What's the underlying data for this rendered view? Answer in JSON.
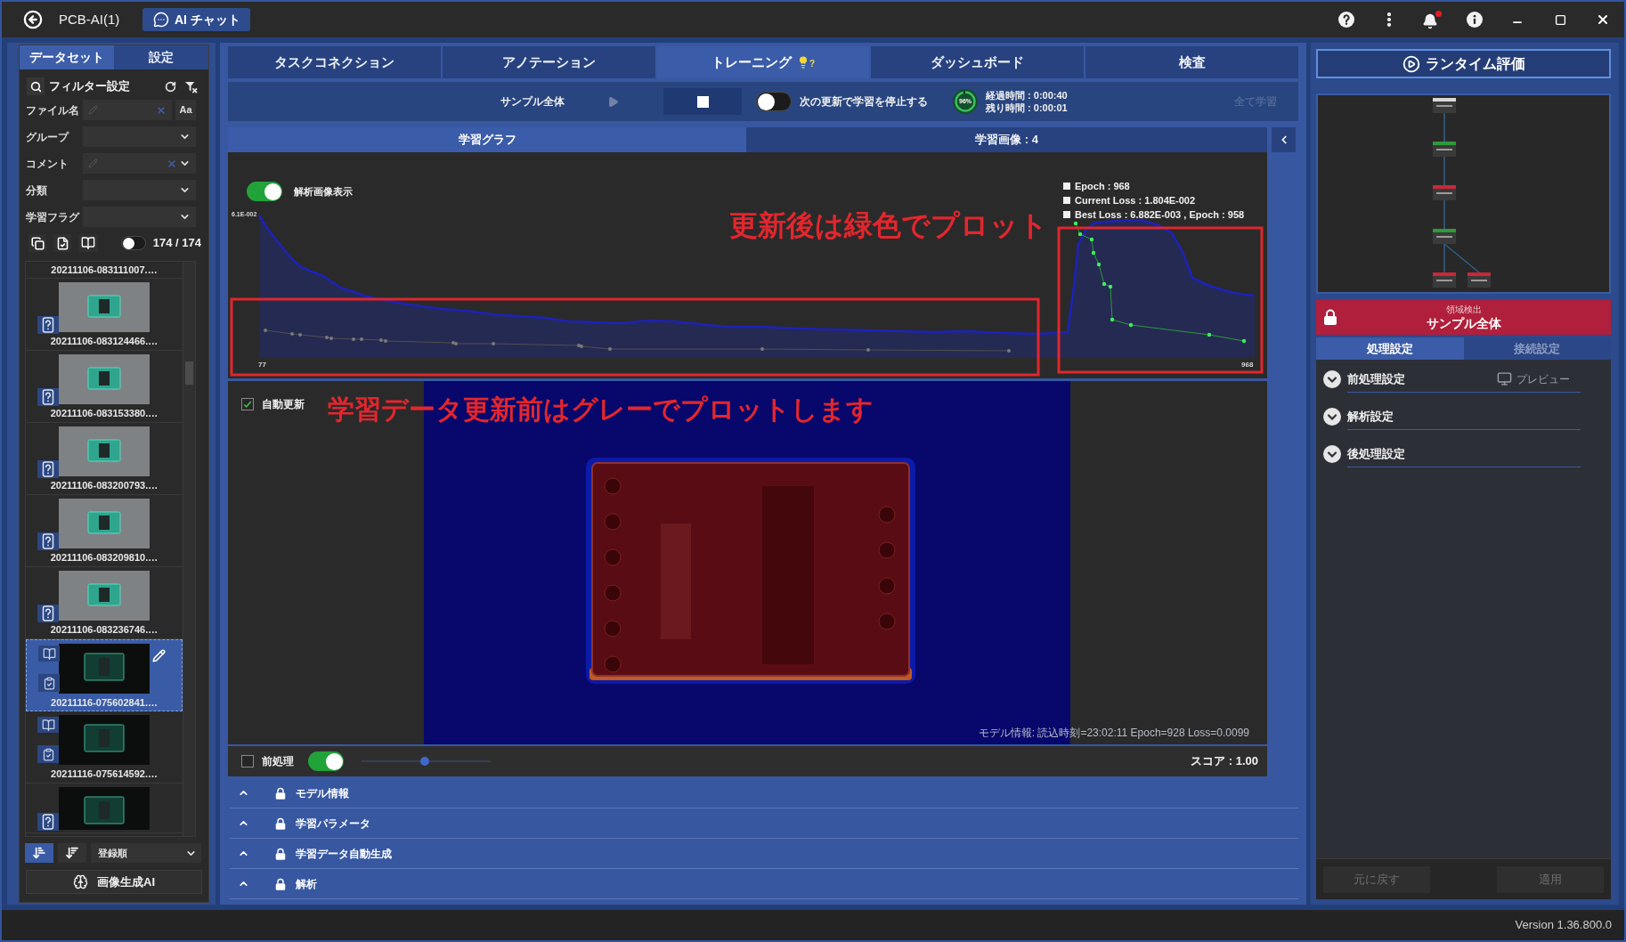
{
  "title_bar": {
    "project": "PCB-AI(1)",
    "chat_button": "AI チャット",
    "notifications_unread": true
  },
  "sidebar": {
    "tabs": [
      {
        "label": "データセット",
        "selected": true
      },
      {
        "label": "設定",
        "selected": false
      }
    ],
    "filter": {
      "title": "フィルター設定",
      "fields": [
        {
          "label": "ファイル名",
          "kind": "text_case"
        },
        {
          "label": "グループ",
          "kind": "select"
        },
        {
          "label": "コメント",
          "kind": "text_select"
        },
        {
          "label": "分類",
          "kind": "select"
        },
        {
          "label": "学習フラグ",
          "kind": "select"
        }
      ]
    },
    "case_button": "Aa",
    "toggle_on": false,
    "count": "174 / 174",
    "images": [
      {
        "name": "20211106-083111007.…",
        "selected": false
      },
      {
        "name": "20211106-083124466.…",
        "selected": false,
        "kind": "unlabeled",
        "dark": false
      },
      {
        "name": "20211106-083153380.…",
        "selected": false,
        "kind": "unlabeled",
        "dark": false
      },
      {
        "name": "20211106-083200793.…",
        "selected": false,
        "kind": "unlabeled",
        "dark": false
      },
      {
        "name": "20211106-083209810.…",
        "selected": false,
        "kind": "unlabeled",
        "dark": false
      },
      {
        "name": "20211106-083236746.…",
        "selected": false,
        "kind": "unlabeled",
        "dark": false
      },
      {
        "name": "20211116-075602841.…",
        "selected": true,
        "kind": "learned",
        "dark": true
      },
      {
        "name": "20211116-075614592.…",
        "selected": false,
        "kind": "learned",
        "dark": true
      },
      {
        "selected": false,
        "kind": "unlabeled",
        "dark": true
      }
    ],
    "sort_buttons": [
      {
        "kind": "ascending",
        "selected": true
      },
      {
        "kind": "descending",
        "selected": false
      }
    ],
    "sort_order": "登録順",
    "generate_button": "画像生成AI"
  },
  "main_tabs": [
    {
      "label": "タスクコネクション",
      "selected": false
    },
    {
      "label": "アノテーション",
      "selected": false
    },
    {
      "label": "トレーニング",
      "selected": true,
      "hint": "?"
    },
    {
      "label": "ダッシュボード",
      "selected": false
    },
    {
      "label": "検査",
      "selected": false
    }
  ],
  "training_bar": {
    "target": "サンプル全体",
    "play_disabled": true,
    "stop_on_next_update": false,
    "stop_label": "次の更新で学習を停止する",
    "progress": {
      "level": 0.96,
      "label": "96%"
    },
    "elapsed": "経過時間 : 0:00:40",
    "remaining": "残り時間 : 0:00:01",
    "continue_button": {
      "label": "全て学習",
      "disabled": true
    }
  },
  "view_tabs": [
    {
      "label": "学習グラフ",
      "selected": true
    },
    {
      "label": "学習画像 : 4",
      "selected": false
    }
  ],
  "graph": {
    "analysis_toggle": {
      "label": "解析画像表示",
      "on": true
    },
    "legend": [
      "Epoch : 968",
      "Current Loss : 1.804E-002",
      "Best Loss : 6.882E-003 , Epoch : 958"
    ],
    "y_max_label": "6.1E-002",
    "x_start_label": "77",
    "x_end_label": "968",
    "note": "更新後は緑色でプロット"
  },
  "preview": {
    "auto_update": {
      "label": "自動更新",
      "checked": true
    },
    "note": "学習データ更新前はグレーでプロットします",
    "model_info": "モデル情報: 読込時刻=23:02:11 Epoch=928 Loss=0.0099",
    "preprocess": {
      "label": "前処理",
      "checked": false
    },
    "overlay_on": true,
    "opacity": {
      "level": 0.49
    },
    "score": "スコア : 1.00"
  },
  "sections": [
    {
      "label": "モデル情報",
      "locked": true,
      "expanded": false
    },
    {
      "label": "学習パラメータ",
      "locked": true,
      "expanded": false
    },
    {
      "label": "学習データ自動生成",
      "locked": true,
      "expanded": false
    },
    {
      "label": "解析",
      "locked": true,
      "expanded": false
    }
  ],
  "right_panel": {
    "runtime_button": "ランタイム評価",
    "node": {
      "category": "領域検出",
      "name": "サンプル全体",
      "locked": true
    },
    "tabs": [
      {
        "label": "処理設定",
        "selected": true
      },
      {
        "label": "接続設定",
        "selected": false
      }
    ],
    "settings": [
      {
        "label": "前処理設定",
        "expanded": false,
        "preview": "プレビュー"
      },
      {
        "label": "解析設定",
        "expanded": false
      },
      {
        "label": "後処理設定",
        "expanded": false
      }
    ],
    "buttons": [
      {
        "label": "元に戻す",
        "disabled": true
      },
      {
        "label": "適用",
        "disabled": true
      }
    ]
  },
  "status_bar": {
    "version": "Version 1.36.800.0"
  }
}
